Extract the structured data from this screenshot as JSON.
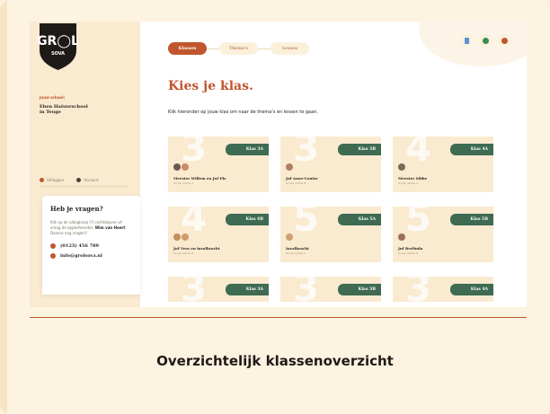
{
  "logo": {
    "text": "GR",
    "text2": "L",
    "sub": "SOVA"
  },
  "sidebar": {
    "school_label": "Jouw school:",
    "school_name_1": "Eben Haëzerschool",
    "school_name_2": "in Teuge",
    "links": [
      {
        "label": "Uitloggen",
        "icon": "logout-icon",
        "color": "#c0562d"
      },
      {
        "label": "Account",
        "icon": "account-icon",
        "color": "#4a4038"
      }
    ]
  },
  "help": {
    "title": "Heb je vragen?",
    "text_1": "Klik op de uitlegknop (?) rechtsboven of vraag de appbeheerder: ",
    "text_bold": "Wim van Heert",
    "text_2": ". Daarna nog vragen?",
    "phone": "(0123) 456 789",
    "email": "info@grolsova.nl"
  },
  "steps": [
    {
      "label": "Klassen",
      "active": true
    },
    {
      "label": "Thema's",
      "active": false
    },
    {
      "label": "Lessen",
      "active": false
    }
  ],
  "top_icons": [
    {
      "name": "document-icon",
      "color": "#5b8fd6"
    },
    {
      "name": "whatsapp-icon",
      "color": "#3e8a52"
    },
    {
      "name": "help-icon",
      "color": "#c0562d"
    }
  ],
  "main": {
    "title": "Kies je klas.",
    "subtitle": "Klik hieronder op jouw klas om naar de thema's en lessen te gaan."
  },
  "classes": [
    {
      "num": "3",
      "tag": "Klas 3A",
      "teacher": "Meester Willem en Juf Els",
      "code": "Groep 3/Klas A",
      "avatars": [
        "#6a5a50",
        "#c88a6a"
      ]
    },
    {
      "num": "3",
      "tag": "Klas 3B",
      "teacher": "Juf Anne-Louise",
      "code": "Groep 3/Klas B",
      "avatars": [
        "#b08060"
      ]
    },
    {
      "num": "4",
      "tag": "Klas 4A",
      "teacher": "Meester Sibbe",
      "code": "Groep 4/Klas A",
      "avatars": [
        "#7a6a5a"
      ]
    },
    {
      "num": "4",
      "tag": "Klas 4B",
      "teacher": "Juf Vera en invalkracht",
      "code": "Groep 4/Klas B",
      "avatars": [
        "#c0905a",
        "#d09a6a"
      ]
    },
    {
      "num": "5",
      "tag": "Klas 5A",
      "teacher": "Invalkracht",
      "code": "Groep 5/Klas A",
      "avatars": [
        "#d0a070"
      ]
    },
    {
      "num": "5",
      "tag": "Klas 5B",
      "teacher": "Juf Berlinda",
      "code": "Groep 5/Klas B",
      "avatars": [
        "#9a7058"
      ]
    },
    {
      "num": "3",
      "tag": "Klas 3A",
      "teacher": "",
      "code": "",
      "avatars": []
    },
    {
      "num": "3",
      "tag": "Klas 3B",
      "teacher": "",
      "code": "",
      "avatars": []
    },
    {
      "num": "3",
      "tag": "Klas 4A",
      "teacher": "",
      "code": "",
      "avatars": []
    }
  ],
  "caption": "Overzichtelijk klassenoverzicht"
}
